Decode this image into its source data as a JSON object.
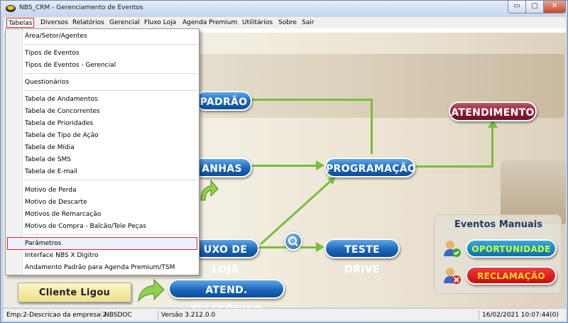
{
  "window": {
    "title": "NBS_CRM - Gerenciamento de Eventos",
    "controls": {
      "minimize": "▭",
      "maximize": "▢",
      "close": "✕"
    }
  },
  "menubar": [
    {
      "label": "Tabelas",
      "active": true
    },
    {
      "label": "Diversos"
    },
    {
      "label": "Relatórios"
    },
    {
      "label": "Gerencial"
    },
    {
      "label": "Fluxo Loja"
    },
    {
      "label": "Agenda Premium"
    },
    {
      "label": "Utilitários"
    },
    {
      "label": "Sobre"
    },
    {
      "label": "Sair"
    }
  ],
  "dropdown": {
    "items": [
      "Área/Setor/Agentes",
      "Tipos de Eventos",
      "Tipos de Eventos - Gerencial",
      "Questionários",
      "Tabela de Andamentos",
      "Tabela de Concorrentes",
      "Tabela de Prioridades",
      "Tabela de Tipo de Ação",
      "Tabela de Mídia",
      "Tabela de SMS",
      "Tabela de E-mail",
      "Motivo de Perda",
      "Motivo de Descarte",
      "Motivos de Remarcação",
      "Motivo de Compra - Balcão/Tele Peças",
      "Parâmetros",
      "Interface NBS X Digitro",
      "Andamento Padrão para Agenda Premium/TSM"
    ]
  },
  "flow": {
    "padrao": "PADRÃO",
    "campanhas": "ANHAS",
    "fluxo_loja": "UXO DE LOJA",
    "programacao": "PROGRAMAÇÃO",
    "atendimento": "ATENDIMENTO",
    "teste_drive": "TESTE DRIVE",
    "cliente_ligou": "Cliente Ligou",
    "atend_telefonico": "ATEND. TELEFÔNICO"
  },
  "manuais": {
    "title": "Eventos Manuais",
    "oportunidade": "OPORTUNIDADE",
    "reclamacao": "RECLAMAÇÃO"
  },
  "statusbar": {
    "empresa": "Emp:2-Descricao da empresa 2",
    "user": "NBSDOC",
    "versao": "Versão 3.212.0.0",
    "datetime": "16/02/2021 10:07:44(0)"
  },
  "colors": {
    "accent_blue": "#1d66b8",
    "accent_red": "#8b1d34",
    "arrow_green": "#7bbd3b",
    "highlight_border": "#d9262a"
  }
}
